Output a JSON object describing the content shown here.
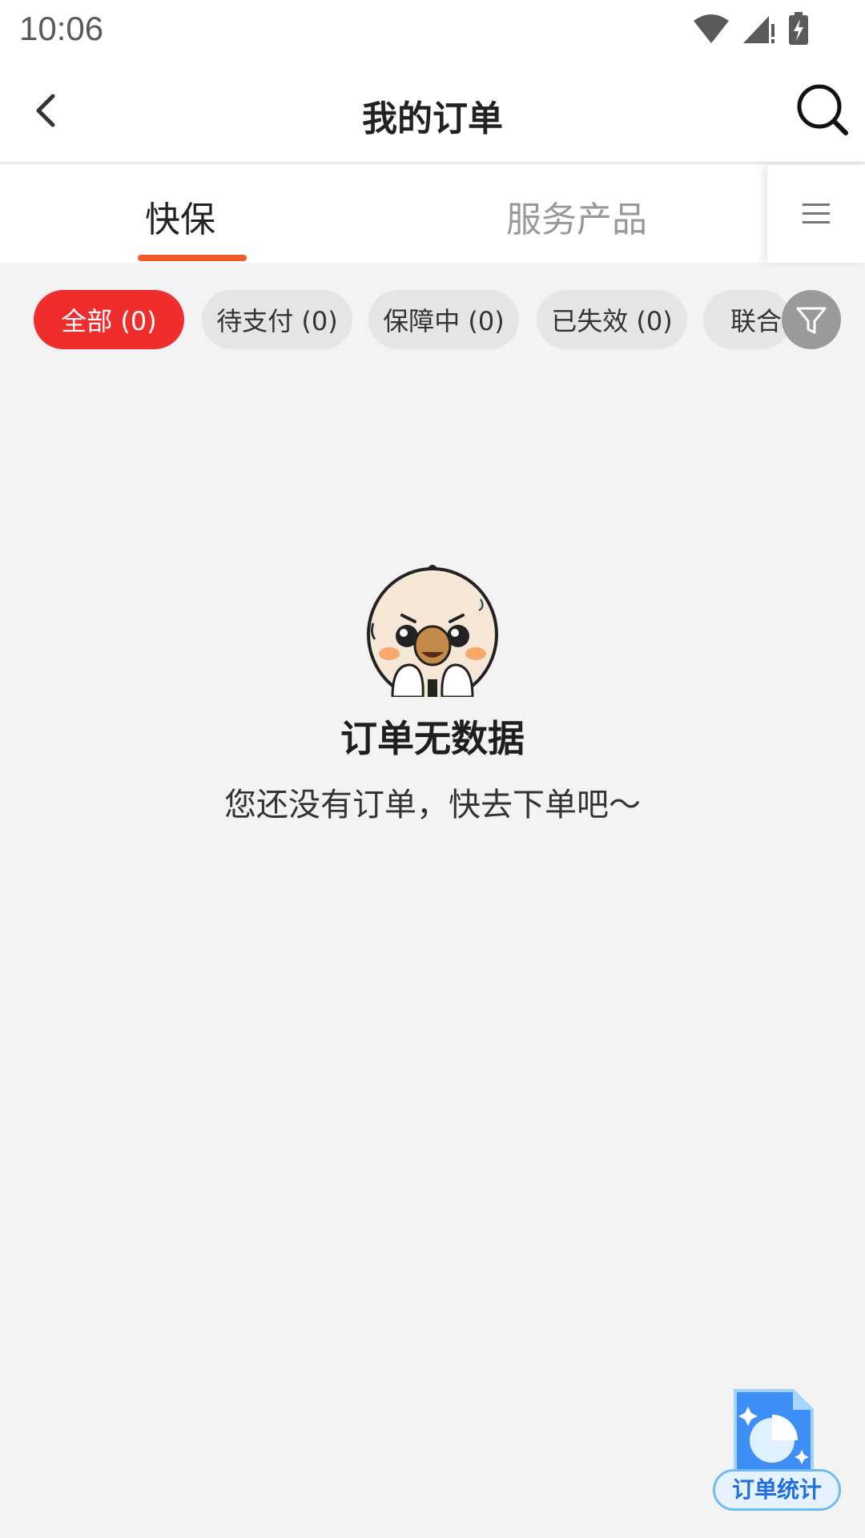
{
  "status_bar": {
    "time": "10:06"
  },
  "header": {
    "title": "我的订单"
  },
  "tabs": [
    {
      "label": "快保",
      "active": true
    },
    {
      "label": "服务产品",
      "active": false
    }
  ],
  "chips": [
    {
      "label": "全部 (0)",
      "active": true
    },
    {
      "label": "待支付 (0)",
      "active": false
    },
    {
      "label": "保障中 (0)",
      "active": false
    },
    {
      "label": "已失效 (0)",
      "active": false
    },
    {
      "label": "联合",
      "active": false
    }
  ],
  "empty_state": {
    "title": "订单无数据",
    "description": "您还没有订单，快去下单吧～"
  },
  "fab": {
    "label": "订单统计"
  },
  "colors": {
    "accent": "#f05a28",
    "chip_active": "#f02d2d",
    "background": "#f4f3f4",
    "fab_blue": "#1f6fe0"
  },
  "icons": [
    "wifi-icon",
    "signal-icon",
    "battery-icon",
    "back-arrow-icon",
    "search-icon",
    "menu-icon",
    "filter-icon",
    "pie-chart-icon"
  ]
}
